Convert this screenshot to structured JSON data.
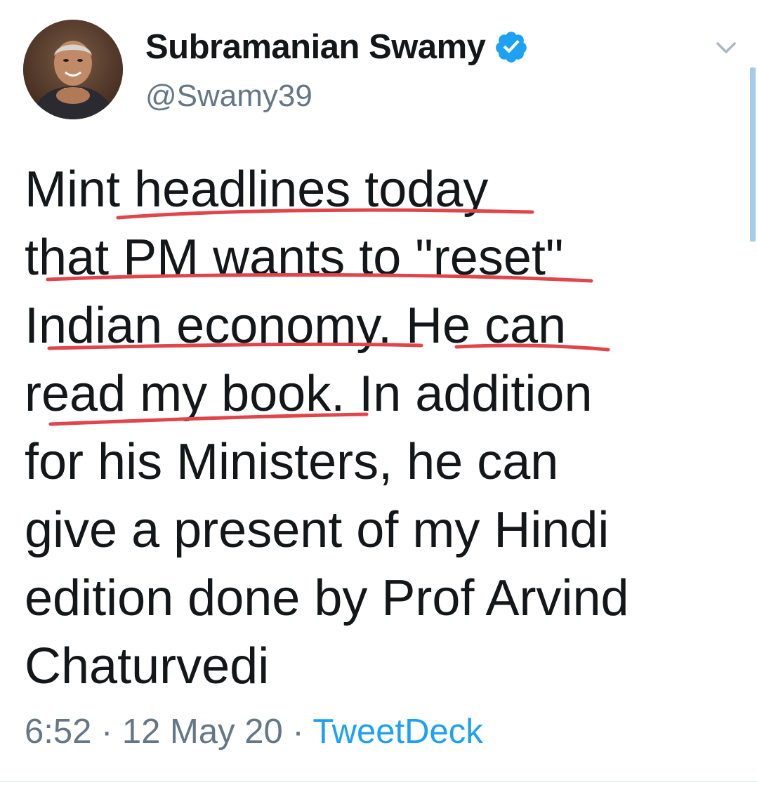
{
  "author": {
    "display_name": "Subramanian Swamy",
    "handle": "@Swamy39",
    "verified": true,
    "avatar_icon": "profile-photo"
  },
  "tweet": {
    "lines": [
      "Mint headlines today",
      "that PM wants to \"reset\"",
      "Indian economy. He can",
      "read my book. In addition",
      "for his Ministers, he can",
      "give a present of my Hindi",
      "edition done by Prof Arvind",
      "Chaturvedi"
    ]
  },
  "footer": {
    "time": "6:52",
    "separator": " · ",
    "date": "12 May 20",
    "source": "TweetDeck"
  },
  "colors": {
    "text_primary": "#14171a",
    "text_secondary": "#657786",
    "link": "#1da1f2",
    "verified_badge": "#1da1f2",
    "annotation_underline": "#e0454c"
  },
  "icons": {
    "verified": "verified-badge-icon",
    "menu": "chevron-down-icon"
  }
}
